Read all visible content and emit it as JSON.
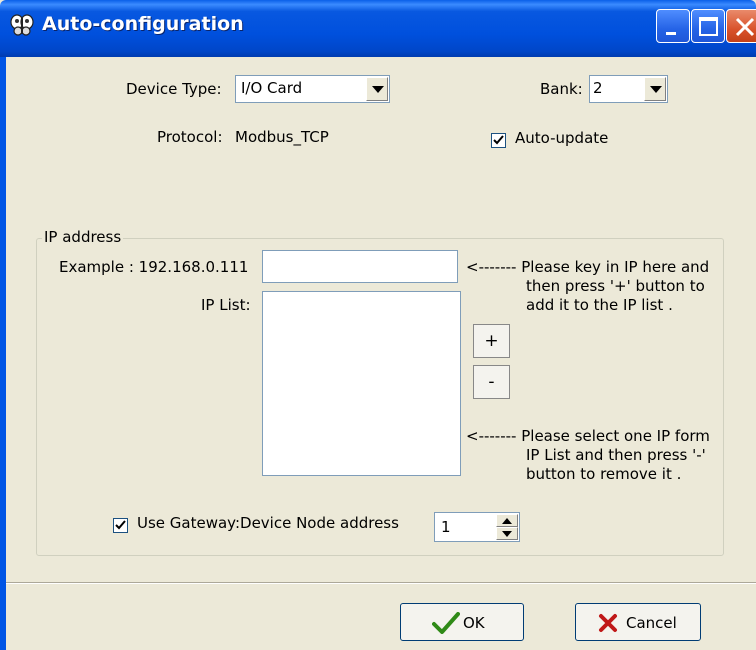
{
  "window": {
    "title": "Auto-configuration",
    "icon": "butterfly-app-icon",
    "controls": [
      "minimize-icon",
      "maximize-icon",
      "close-icon"
    ]
  },
  "device_type": {
    "label": "Device Type:",
    "value": "I/O Card"
  },
  "bank": {
    "label": "Bank:",
    "value": "2"
  },
  "protocol": {
    "label": "Protocol:",
    "value": "Modbus_TCP"
  },
  "auto_update": {
    "label": "Auto-update",
    "checked": true
  },
  "ip_group": {
    "title": "IP address",
    "example_label": "Example : 192.168.0.111",
    "ip_input_value": "",
    "hint_add": [
      "<-------  Please key in IP here and",
      "then press '+' button to",
      "add it to the IP list ."
    ],
    "ip_list_label": "IP List:",
    "ip_list_items": [],
    "add_button": "+",
    "remove_button": "-",
    "hint_remove": [
      "<-------  Please select one IP form",
      "IP List and then press '-'",
      "button to remove it ."
    ]
  },
  "gateway": {
    "label": "Use Gateway:Device Node address",
    "checked": true,
    "node_address": "1"
  },
  "buttons": {
    "ok": "OK",
    "cancel": "Cancel"
  },
  "colors": {
    "titlebar": "#0050dd",
    "dialog_bg": "#ece9d8",
    "ok_check": "#2f8a17",
    "cancel_x": "#c01818"
  }
}
